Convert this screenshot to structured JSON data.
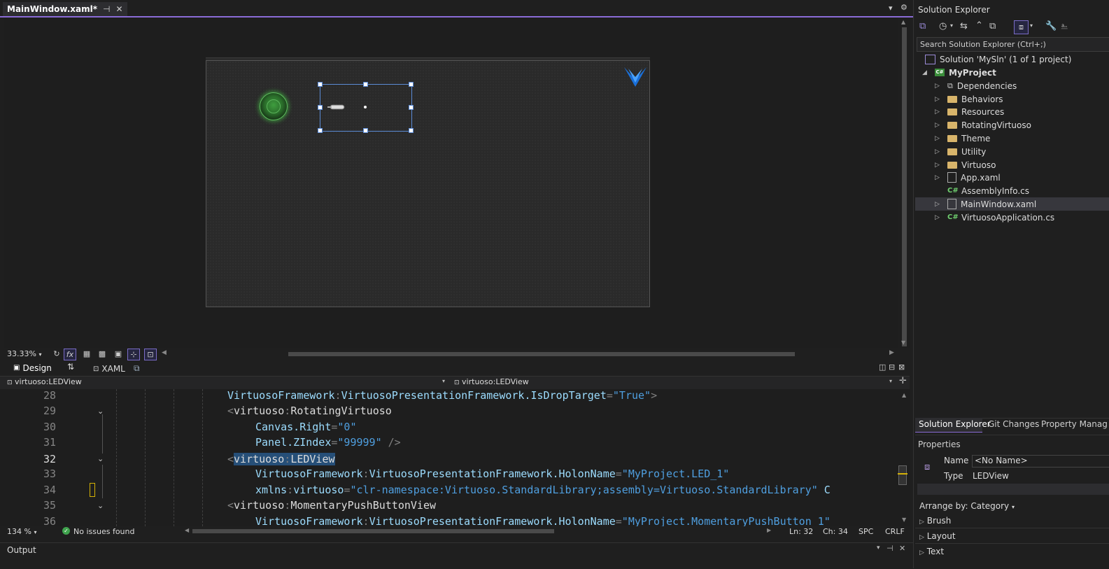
{
  "doc_tab": {
    "title": "MainWindow.xaml*",
    "pin": "⊣",
    "close": "✕"
  },
  "designer": {
    "zoom": "33.33%",
    "fx": "fx"
  },
  "split": {
    "design_label": "Design",
    "swap_icon": "⇅",
    "xaml_label": "XAML"
  },
  "nav": {
    "left": "virtuoso:LEDView",
    "right": "virtuoso:LEDView"
  },
  "editor": {
    "lines": [
      {
        "num": "28",
        "current": false
      },
      {
        "num": "29",
        "current": false
      },
      {
        "num": "30",
        "current": false
      },
      {
        "num": "31",
        "current": false
      },
      {
        "num": "32",
        "current": true
      },
      {
        "num": "33",
        "current": false
      },
      {
        "num": "34",
        "current": false
      },
      {
        "num": "35",
        "current": false
      },
      {
        "num": "36",
        "current": false
      }
    ],
    "code": {
      "l28": [
        "VirtuosoFramework",
        ":",
        "VirtuosoPresentationFramework.IsDropTarget",
        "=",
        "\"True\"",
        ">"
      ],
      "l29": [
        "<",
        "virtuoso",
        ":",
        "RotatingVirtuoso"
      ],
      "l30": [
        "Canvas.Right",
        "=",
        "\"0\""
      ],
      "l31": [
        "Panel.ZIndex",
        "=",
        "\"99999\"",
        "/>"
      ],
      "l32": [
        "<",
        "virtuoso",
        ":",
        "LEDView"
      ],
      "l33": [
        "VirtuosoFramework",
        ":",
        "VirtuosoPresentationFramework.HolonName",
        "=",
        "\"MyProject.LED_1\""
      ],
      "l34": [
        "xmlns",
        ":",
        "virtuoso",
        "=",
        "\"clr-namespace:Virtuoso.StandardLibrary;assembly=Virtuoso.StandardLibrary\"",
        "C"
      ],
      "l35": [
        "<",
        "virtuoso",
        ":",
        "MomentaryPushButtonView"
      ],
      "l36": [
        "VirtuosoFramework",
        ":",
        "VirtuosoPresentationFramework.HolonName",
        "=",
        "\"MyProject.MomentaryPushButton_1\""
      ]
    }
  },
  "status": {
    "zoom": "134 %",
    "issues": "No issues found",
    "line": "Ln: 32",
    "col": "Ch: 34",
    "mode": "SPC",
    "eol": "CRLF"
  },
  "output": {
    "title": "Output"
  },
  "solution_explorer": {
    "title": "Solution Explorer",
    "search_placeholder": "Search Solution Explorer (Ctrl+;)",
    "solution": "Solution 'MySln' (1 of 1 project)",
    "project": "MyProject",
    "items": [
      {
        "label": "Dependencies",
        "icon": "dependencies-icon"
      },
      {
        "label": "Behaviors",
        "icon": "folder-icon"
      },
      {
        "label": "Resources",
        "icon": "folder-icon"
      },
      {
        "label": "RotatingVirtuoso",
        "icon": "folder-icon"
      },
      {
        "label": "Theme",
        "icon": "folder-icon"
      },
      {
        "label": "Utility",
        "icon": "folder-icon"
      },
      {
        "label": "Virtuoso",
        "icon": "folder-icon"
      },
      {
        "label": "App.xaml",
        "icon": "xaml-file-icon"
      },
      {
        "label": "AssemblyInfo.cs",
        "icon": "csharp-file-icon"
      },
      {
        "label": "MainWindow.xaml",
        "icon": "xaml-file-icon"
      },
      {
        "label": "VirtuosoApplication.cs",
        "icon": "csharp-file-icon"
      }
    ],
    "cs_glyph": "C#"
  },
  "bottom_tabs": [
    "Solution Explorer",
    "Git Changes",
    "Property Manag"
  ],
  "properties": {
    "title": "Properties",
    "name_label": "Name",
    "name_value": "<No Name>",
    "type_label": "Type",
    "type_value": "LEDView",
    "arrange": "Arrange by: Category",
    "groups": [
      "Brush",
      "Layout",
      "Text"
    ]
  },
  "colors": {
    "accent": "#8a6bd6",
    "selection": "#5b8bd6",
    "led": "#3f9e3f"
  }
}
